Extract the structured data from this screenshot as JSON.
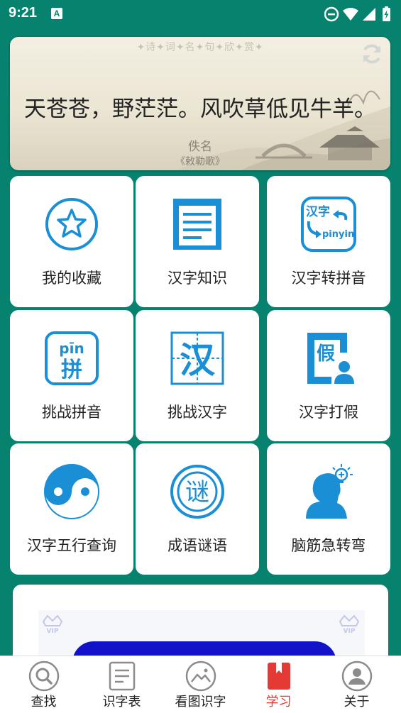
{
  "status_bar": {
    "time": "9:21",
    "notification_glyph": "A"
  },
  "poem": {
    "header": "✦诗✦词✦名✦句✦欣✦赏✦",
    "text": "天苍苍，野茫茫。风吹草低见牛羊。",
    "author": "佚名",
    "source": "《敕勒歌》"
  },
  "features": [
    {
      "label": "我的收藏",
      "icon": "star-circle-icon"
    },
    {
      "label": "汉字知识",
      "icon": "document-icon"
    },
    {
      "label": "汉字转拼音",
      "icon": "hanzi-to-pinyin-icon"
    },
    {
      "label": "挑战拼音",
      "icon": "pinyin-challenge-icon"
    },
    {
      "label": "挑战汉字",
      "icon": "hanzi-challenge-icon"
    },
    {
      "label": "汉字打假",
      "icon": "hanzi-fake-icon"
    },
    {
      "label": "汉字五行查询",
      "icon": "yin-yang-icon"
    },
    {
      "label": "成语谜语",
      "icon": "riddle-seal-icon"
    },
    {
      "label": "脑筋急转弯",
      "icon": "brain-teaser-icon"
    }
  ],
  "icon_text": {
    "hanzi": "汉字",
    "pinyin": "pinyin",
    "pin_py": "pīn",
    "pin_char": "拼",
    "han_char": "汉",
    "jia_char": "假",
    "riddle_char": "谜"
  },
  "ad": {
    "badge_left": "VIP",
    "badge_right": "VIP"
  },
  "bottom_nav": {
    "active": "学习",
    "items": [
      {
        "label": "查找",
        "icon": "search-icon"
      },
      {
        "label": "识字表",
        "icon": "list-icon"
      },
      {
        "label": "看图识字",
        "icon": "image-icon"
      },
      {
        "label": "学习",
        "icon": "bookmark-icon"
      },
      {
        "label": "关于",
        "icon": "user-icon"
      }
    ]
  },
  "colors": {
    "background": "#06826f",
    "accent_blue": "#1a8fd6",
    "active_red": "#e53935"
  }
}
